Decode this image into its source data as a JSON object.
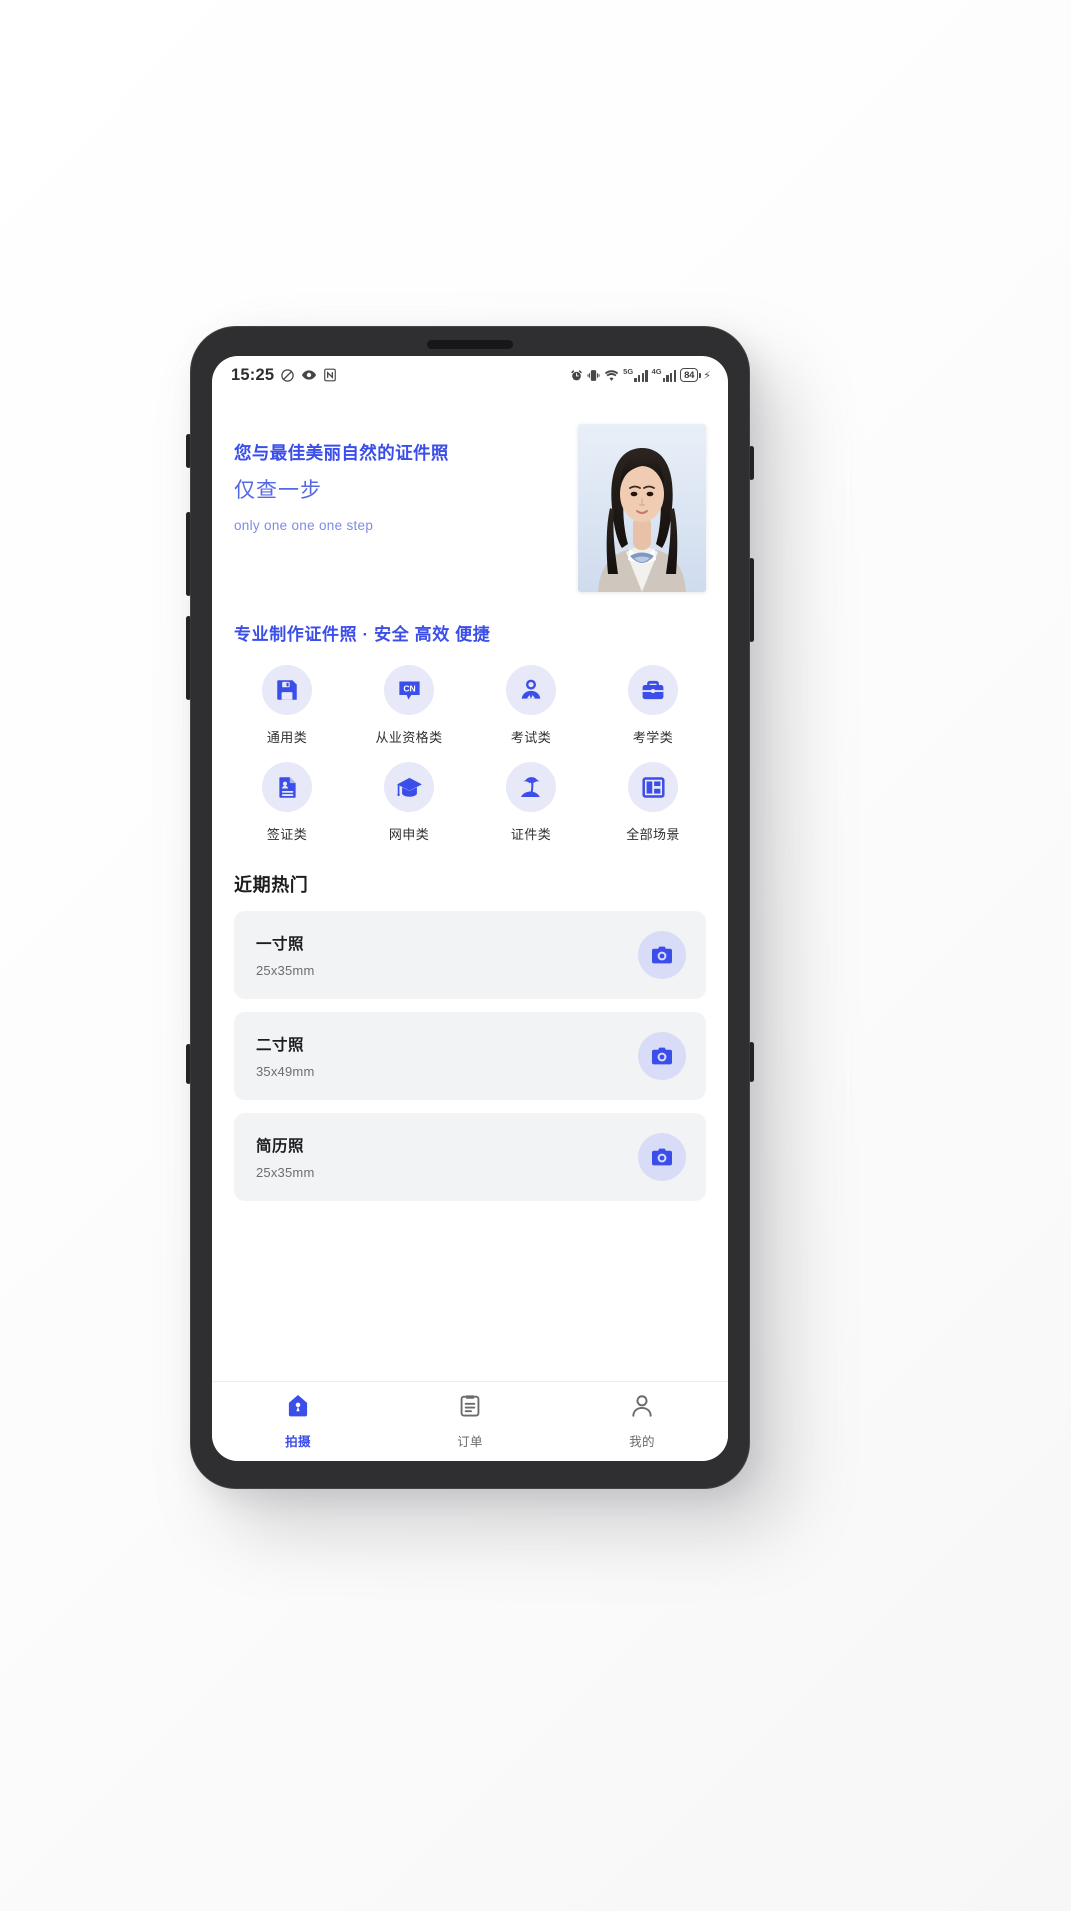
{
  "status_bar": {
    "time": "15:25",
    "left_icons": [
      "do-not-disturb-icon",
      "eye-icon",
      "nfc-icon"
    ],
    "right_icons": [
      "alarm-icon",
      "vibrate-icon",
      "wifi-icon"
    ],
    "network_1": "5G",
    "network_2": "4G",
    "battery_level": "84",
    "charging": true
  },
  "hero": {
    "line1": "您与最佳美丽自然的证件照",
    "line2": "仅查一步",
    "line3": "only one one one step",
    "photo_alt": "id-photo-sample"
  },
  "promo": {
    "title": "专业制作证件照 · 安全 高效 便捷"
  },
  "categories": [
    {
      "label": "通用类",
      "icon": "floppy-disk-icon"
    },
    {
      "label": "从业资格类",
      "icon": "cn-badge-icon"
    },
    {
      "label": "考试类",
      "icon": "person-icon"
    },
    {
      "label": "考学类",
      "icon": "briefcase-icon"
    },
    {
      "label": "签证类",
      "icon": "id-document-icon"
    },
    {
      "label": "网申类",
      "icon": "graduation-cap-icon"
    },
    {
      "label": "证件类",
      "icon": "palm-tree-icon"
    },
    {
      "label": "全部场景",
      "icon": "grid-layout-icon"
    }
  ],
  "hot_section": {
    "title": "近期热门",
    "items": [
      {
        "name": "一寸照",
        "size": "25x35mm",
        "action_icon": "camera-icon"
      },
      {
        "name": "二寸照",
        "size": "35x49mm",
        "action_icon": "camera-icon"
      },
      {
        "name": "简历照",
        "size": "25x35mm",
        "action_icon": "camera-icon"
      }
    ]
  },
  "tabbar": {
    "items": [
      {
        "label": "拍摄",
        "icon": "home-pin-icon",
        "active": true
      },
      {
        "label": "订单",
        "icon": "clipboard-icon",
        "active": false
      },
      {
        "label": "我的",
        "icon": "user-icon",
        "active": false
      }
    ]
  },
  "colors": {
    "primary": "#3B4EEA",
    "primary_soft": "#E7E8F8",
    "card_bg": "#F2F3F4",
    "text_dark": "#1d1d1f",
    "text_muted": "#6d6d70"
  }
}
